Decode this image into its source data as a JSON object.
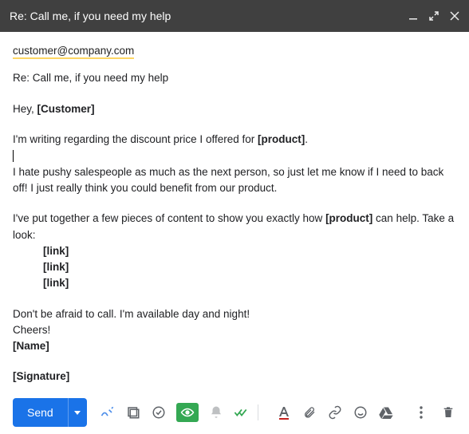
{
  "window": {
    "title": "Re: Call me, if you need my help"
  },
  "email": {
    "to": "customer@company.com",
    "subject": "Re: Call me, if you need my help",
    "greeting_prefix": "Hey, ",
    "greeting_name": "[Customer]",
    "line1_prefix": "I'm writing regarding the discount price I offered for ",
    "line1_product": "[product]",
    "line1_suffix": ".",
    "line2": "I hate pushy salespeople as much as the next person, so just let me know if I need to back off! I just really think you could benefit from our product.",
    "line3_prefix": "I've put together a few pieces of content to show you exactly how ",
    "line3_product": "[product]",
    "line3_suffix": " can help. Take a look:",
    "link1": "[link]",
    "link2": "[link]",
    "link3": "[link]",
    "closing": "Don't be afraid to call. I'm available day and night!",
    "cheers": "Cheers!",
    "name": "[Name]",
    "signature": "[Signature]"
  },
  "toolbar": {
    "send_label": "Send"
  },
  "colors": {
    "primary": "#1a73e8",
    "highlight": "#fdd663",
    "icon": "#5f6368",
    "green": "#34a853"
  }
}
